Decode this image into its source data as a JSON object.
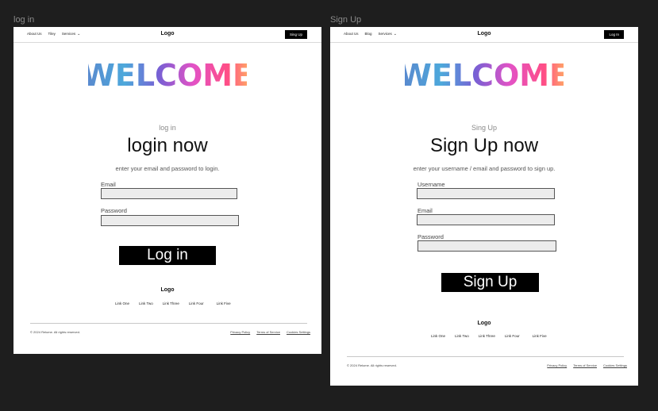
{
  "frames": {
    "login": {
      "frame_label": "log in",
      "nav": {
        "links": [
          "About Us",
          "Tiley",
          "Services"
        ],
        "logo": "Logo",
        "button": "Sing Up"
      },
      "welcome": "WELCOME",
      "subtitle": "log in",
      "heading": "login now",
      "description": "enter your email and password to login.",
      "fields": [
        {
          "label": "Email",
          "value": ""
        },
        {
          "label": "Password",
          "value": ""
        }
      ],
      "submit": "Log in",
      "footer": {
        "logo": "Logo",
        "links": [
          "Link One",
          "Link Two",
          "Link Three",
          "Link Four",
          "Link Five"
        ],
        "copyright": "© 2024 Relume. All rights reserved.",
        "legal": [
          "Privacy Policy",
          "Terms of Service",
          "Cookies Settings"
        ]
      }
    },
    "signup": {
      "frame_label": "Sign Up",
      "nav": {
        "links": [
          "About Us",
          "Blog",
          "Services"
        ],
        "logo": "Logo",
        "button": "Log In"
      },
      "welcome": "WELCOME",
      "subtitle": "Sing Up",
      "heading": "Sign Up now",
      "description": "enter your username / email and password to sign up.",
      "fields": [
        {
          "label": "Username",
          "value": ""
        },
        {
          "label": "Email",
          "value": ""
        },
        {
          "label": "Password",
          "value": ""
        }
      ],
      "submit": "Sign Up",
      "footer": {
        "logo": "Logo",
        "links": [
          "Link One",
          "Link Two",
          "Link Three",
          "Link Four",
          "Link Five"
        ],
        "copyright": "© 2024 Relume. All rights reserved.",
        "legal": [
          "Privacy Policy",
          "Terms of Service",
          "Cookies Settings"
        ]
      }
    }
  },
  "colors": {
    "canvas_bg": "#1e1e1e",
    "frame_bg": "#ffffff",
    "button_bg": "#000000",
    "input_bg": "#ececec",
    "welcome_palette": [
      "#4a78c8",
      "#3aa0d8",
      "#6a4fd0",
      "#e040c0",
      "#ff3b7a",
      "#ff8a3d",
      "#ffb34d"
    ]
  }
}
